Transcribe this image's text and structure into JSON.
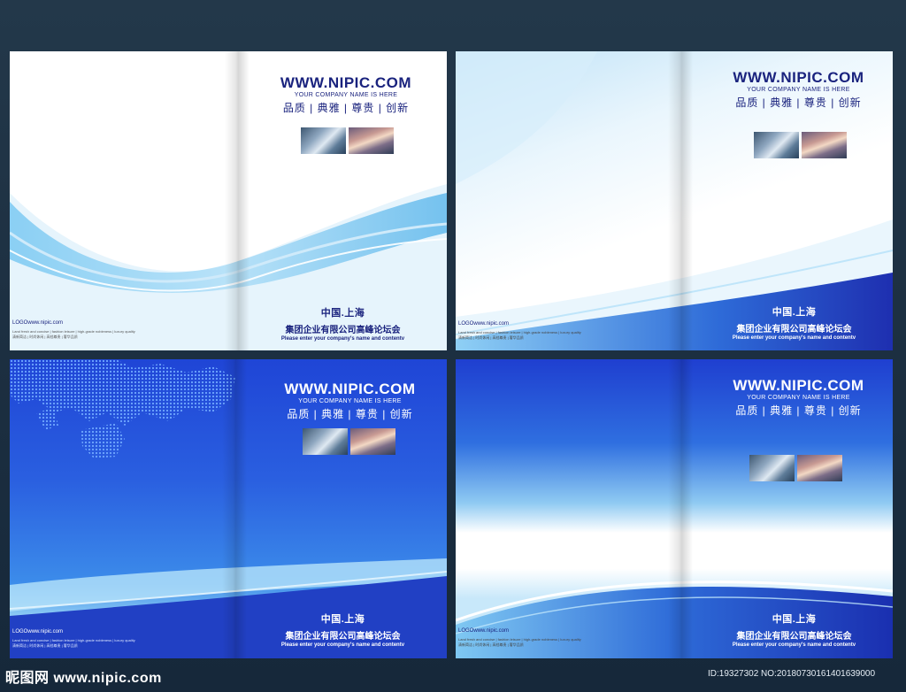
{
  "brand": {
    "url": "WWW.NIPIC.COM",
    "tagline": "YOUR COMPANY NAME IS HERE",
    "slogan": "品质 | 典雅 | 尊贵 | 创新"
  },
  "bottom": {
    "city": "中国.上海",
    "company": "集团企业有限公司高峰论坛会",
    "tag_en": "Please enter your company's name and contentv"
  },
  "logo_text": "LOGOwww.nipic.com",
  "tiny_line1": "Land fresh and concise | fashion leisure | high-grade nobleness | luxury quality",
  "tiny_line2": "清新简洁 | 时尚休闲 | 高档尊贵 | 奢华品质",
  "footer": {
    "watermark": "昵图网 www.nipic.com",
    "id_text": "ID:19327302 NO:20180730161401639000"
  },
  "colors": {
    "navy": "#1a237e",
    "royal_blue": "#1e3fd0",
    "light_blue": "#8fd0f5",
    "background": "#1d3042"
  }
}
